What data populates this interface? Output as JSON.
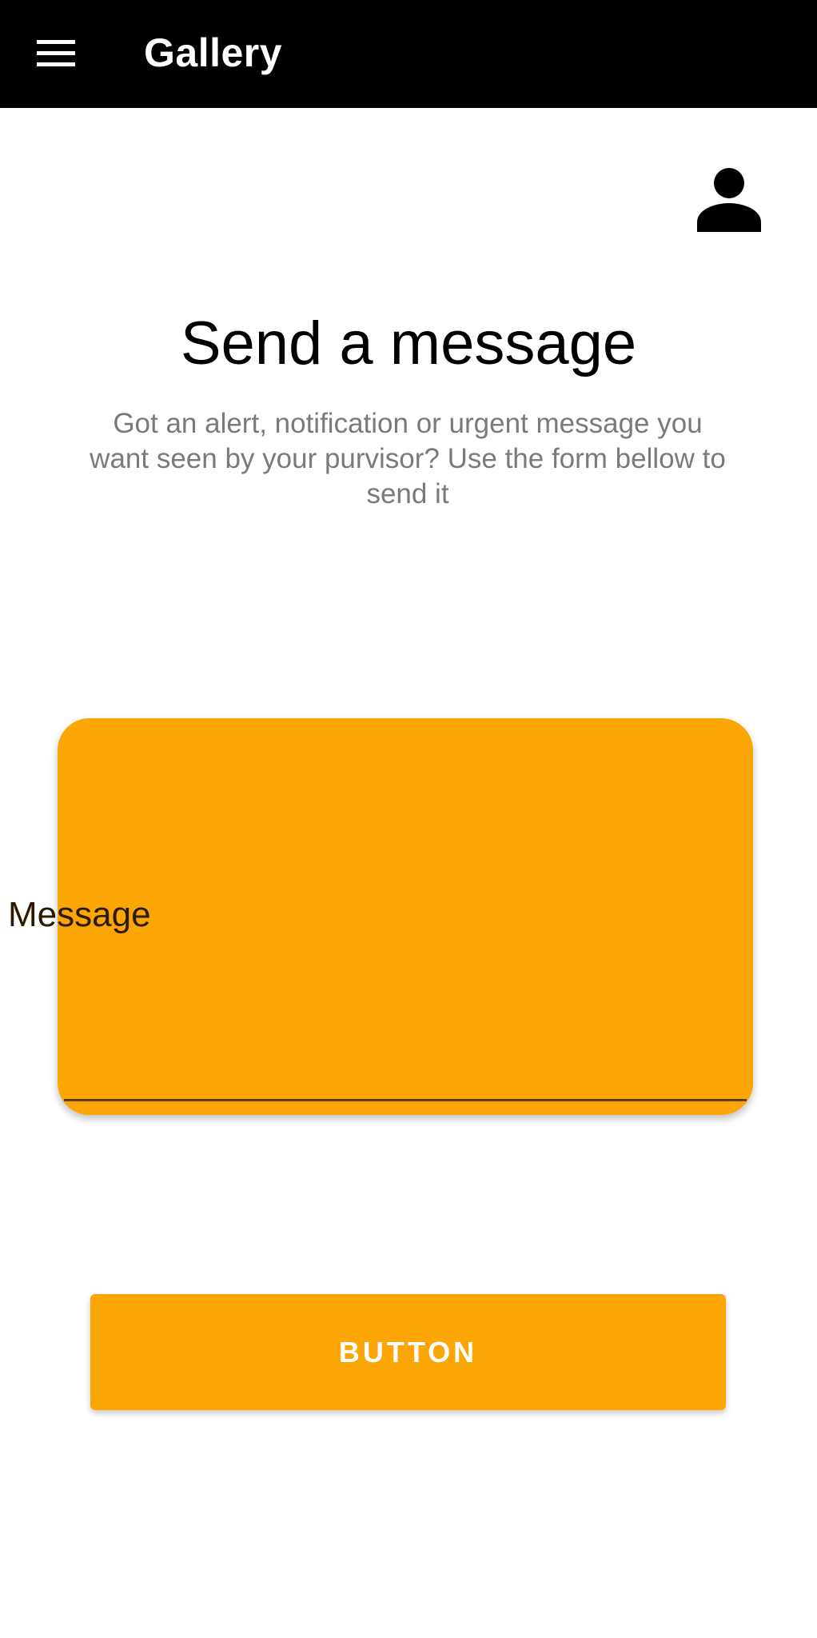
{
  "app_bar": {
    "title": "Gallery",
    "menu_icon": "hamburger-menu-icon",
    "background": "#000000",
    "text_color": "#ffffff"
  },
  "profile": {
    "icon": "account-person-icon"
  },
  "main": {
    "title": "Send a message",
    "subtitle": "Got an alert, notification or urgent message you want seen by your purvisor? Use the form bellow to send it"
  },
  "form": {
    "message_label": "Message",
    "message_value": "",
    "submit_label": "BUTTON"
  },
  "colors": {
    "accent": "#fba604",
    "subtitle_text": "#7a7a7a",
    "field_label": "#2b1a00"
  }
}
